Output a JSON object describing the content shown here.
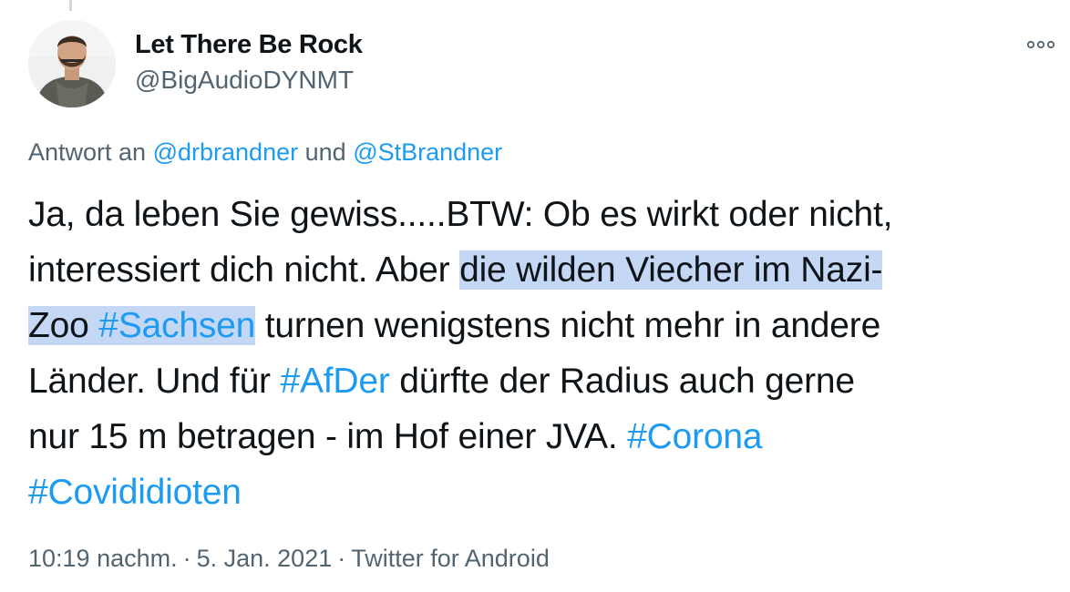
{
  "author": {
    "display_name": "Let There Be Rock",
    "handle": "@BigAudioDYNMT"
  },
  "reply": {
    "prefix": "Antwort an",
    "mention_1": "@drbrandner",
    "conjunction": "und",
    "mention_2": "@StBrandner"
  },
  "tweet": {
    "line_1": "Ja, da leben Sie gewiss.....BTW: Ob es wirkt oder nicht,",
    "line_2_plain": "interessiert dich nicht. Aber ",
    "line_2_highlight": "die wilden Viecher im Nazi-",
    "line_3_highlight": "Zoo ",
    "line_3_hashtag": "#Sachsen",
    "line_3_plain": " turnen wenigstens nicht mehr in andere",
    "line_4_plain_a": "Länder. Und für ",
    "line_4_hashtag": "#AfDer",
    "line_4_plain_b": " dürfte der Radius auch gerne",
    "line_5_plain": "nur 15 m betragen - im Hof einer JVA. ",
    "line_5_hashtag": "#Corona",
    "line_6_hashtag": "#Covididioten"
  },
  "meta": {
    "time": "10:19 nachm.",
    "date": "5. Jan. 2021",
    "source": "Twitter for Android",
    "separator": "·"
  },
  "icons": {
    "more": "more-options-icon",
    "avatar": "profile-avatar"
  },
  "colors": {
    "link": "#1d9bf0",
    "secondary_text": "#536471",
    "primary_text": "#0f1419",
    "selection_highlight": "#c4d8f5"
  }
}
